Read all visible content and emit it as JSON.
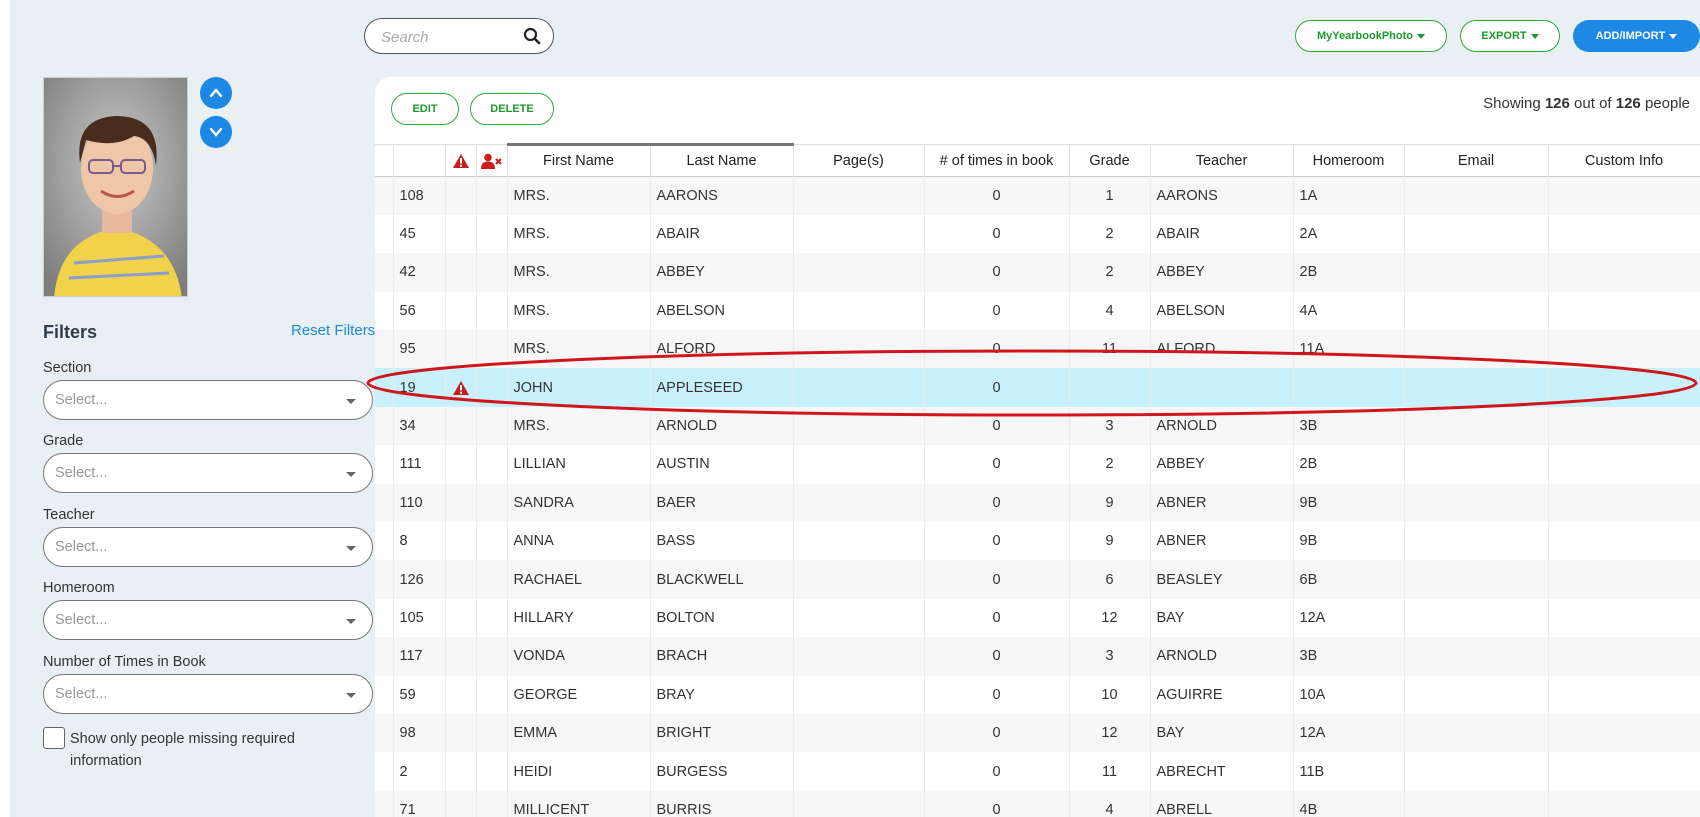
{
  "search": {
    "placeholder": "Search"
  },
  "header_buttons": {
    "photo": "MyYearbookPhoto",
    "export": "EXPORT",
    "add": "ADD/IMPORT"
  },
  "actions": {
    "edit": "EDIT",
    "delete": "DELETE"
  },
  "showing": {
    "prefix": "Showing",
    "shown": "126",
    "middle": "out of",
    "total": "126",
    "suffix": "people"
  },
  "filters": {
    "title": "Filters",
    "reset": "Reset Filters",
    "fields": [
      {
        "label": "Section",
        "placeholder": "Select..."
      },
      {
        "label": "Grade",
        "placeholder": "Select..."
      },
      {
        "label": "Teacher",
        "placeholder": "Select..."
      },
      {
        "label": "Homeroom",
        "placeholder": "Select..."
      },
      {
        "label": "Number of Times in Book",
        "placeholder": "Select..."
      }
    ],
    "missing_checkbox": "Show only people missing required information"
  },
  "table": {
    "columns": [
      "",
      "",
      "",
      "First Name",
      "Last Name",
      "Page(s)",
      "# of times in book",
      "Grade",
      "Teacher",
      "Homeroom",
      "Email",
      "Custom Info"
    ],
    "rows": [
      {
        "id": "108",
        "warn": false,
        "first": "MRS.",
        "last": "AARONS",
        "pages": "",
        "times": "0",
        "grade": "1",
        "teacher": "AARONS",
        "homeroom": "1A"
      },
      {
        "id": "45",
        "warn": false,
        "first": "MRS.",
        "last": "ABAIR",
        "pages": "",
        "times": "0",
        "grade": "2",
        "teacher": "ABAIR",
        "homeroom": "2A"
      },
      {
        "id": "42",
        "warn": false,
        "first": "MRS.",
        "last": "ABBEY",
        "pages": "",
        "times": "0",
        "grade": "2",
        "teacher": "ABBEY",
        "homeroom": "2B"
      },
      {
        "id": "56",
        "warn": false,
        "first": "MRS.",
        "last": "ABELSON",
        "pages": "",
        "times": "0",
        "grade": "4",
        "teacher": "ABELSON",
        "homeroom": "4A"
      },
      {
        "id": "95",
        "warn": false,
        "first": "MRS.",
        "last": "ALFORD",
        "pages": "",
        "times": "0",
        "grade": "11",
        "teacher": "ALFORD",
        "homeroom": "11A"
      },
      {
        "id": "19",
        "warn": true,
        "first": "JOHN",
        "last": "APPLESEED",
        "pages": "",
        "times": "0",
        "grade": "",
        "teacher": "",
        "homeroom": "",
        "highlight": true
      },
      {
        "id": "34",
        "warn": false,
        "first": "MRS.",
        "last": "ARNOLD",
        "pages": "",
        "times": "0",
        "grade": "3",
        "teacher": "ARNOLD",
        "homeroom": "3B"
      },
      {
        "id": "111",
        "warn": false,
        "first": "LILLIAN",
        "last": "AUSTIN",
        "pages": "",
        "times": "0",
        "grade": "2",
        "teacher": "ABBEY",
        "homeroom": "2B"
      },
      {
        "id": "110",
        "warn": false,
        "first": "SANDRA",
        "last": "BAER",
        "pages": "",
        "times": "0",
        "grade": "9",
        "teacher": "ABNER",
        "homeroom": "9B"
      },
      {
        "id": "8",
        "warn": false,
        "first": "ANNA",
        "last": "BASS",
        "pages": "",
        "times": "0",
        "grade": "9",
        "teacher": "ABNER",
        "homeroom": "9B"
      },
      {
        "id": "126",
        "warn": false,
        "first": "RACHAEL",
        "last": "BLACKWELL",
        "pages": "",
        "times": "0",
        "grade": "6",
        "teacher": "BEASLEY",
        "homeroom": "6B"
      },
      {
        "id": "105",
        "warn": false,
        "first": "HILLARY",
        "last": "BOLTON",
        "pages": "",
        "times": "0",
        "grade": "12",
        "teacher": "BAY",
        "homeroom": "12A"
      },
      {
        "id": "117",
        "warn": false,
        "first": "VONDA",
        "last": "BRACH",
        "pages": "",
        "times": "0",
        "grade": "3",
        "teacher": "ARNOLD",
        "homeroom": "3B"
      },
      {
        "id": "59",
        "warn": false,
        "first": "GEORGE",
        "last": "BRAY",
        "pages": "",
        "times": "0",
        "grade": "10",
        "teacher": "AGUIRRE",
        "homeroom": "10A"
      },
      {
        "id": "98",
        "warn": false,
        "first": "EMMA",
        "last": "BRIGHT",
        "pages": "",
        "times": "0",
        "grade": "12",
        "teacher": "BAY",
        "homeroom": "12A"
      },
      {
        "id": "2",
        "warn": false,
        "first": "HEIDI",
        "last": "BURGESS",
        "pages": "",
        "times": "0",
        "grade": "11",
        "teacher": "ABRECHT",
        "homeroom": "11B"
      },
      {
        "id": "71",
        "warn": false,
        "first": "MILLICENT",
        "last": "BURRIS",
        "pages": "",
        "times": "0",
        "grade": "4",
        "teacher": "ABRELL",
        "homeroom": "4B"
      }
    ]
  },
  "icons": {
    "search": "search-icon",
    "warning": "warning-icon",
    "missing_person": "user-remove-icon",
    "up": "chevron-up-icon",
    "down": "chevron-down-icon"
  },
  "colors": {
    "accent": "#1e88e5",
    "green": "#2faa3b",
    "highlight_row": "#c9f1fb",
    "annotation": "#d0161c",
    "warning": "#cc1b1b"
  }
}
